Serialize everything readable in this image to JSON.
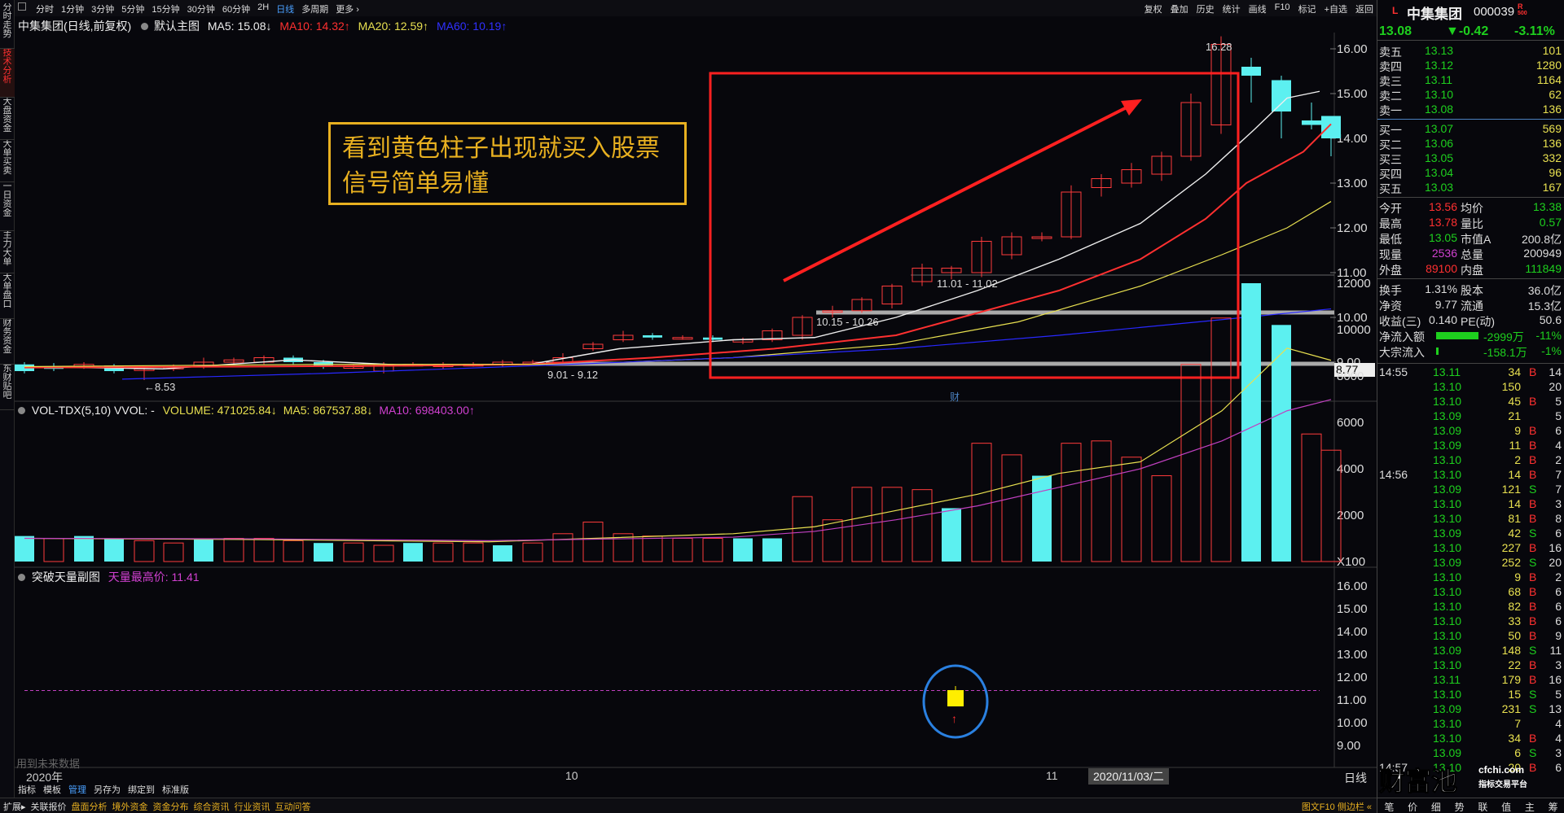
{
  "left_nav": [
    "分时走势",
    "技术分析",
    "大盘资金",
    "大单买卖",
    "一日资金",
    "主力大单",
    "大单盘口",
    "财务资金",
    "东财贴吧"
  ],
  "periods": [
    "分时",
    "1分钟",
    "3分钟",
    "5分钟",
    "15分钟",
    "30分钟",
    "60分钟",
    "2H",
    "日线",
    "多周期",
    "更多 ›"
  ],
  "period_active": "日线",
  "right_toolbar": [
    "复权",
    "叠加",
    "历史",
    "统计",
    "画线",
    "F10",
    "标记",
    "+自选",
    "返回"
  ],
  "main_info": {
    "stock": "中集集团(日线,前复权)",
    "template": "默认主图",
    "ma5": "MA5: 15.08↓",
    "ma10": "MA10: 14.32↑",
    "ma20": "MA20: 12.59↑",
    "ma60": "MA60: 10.19↑"
  },
  "price_axis": [
    "16.00",
    "15.00",
    "14.00",
    "13.00",
    "12.00",
    "11.00",
    "10.00",
    "9.00"
  ],
  "current_price_tag": "8.77",
  "annotations": {
    "high": "16.28",
    "low": "←8.53",
    "range1": "9.01 - 9.12",
    "range2": "10.15 - 10.26",
    "range3": "11.01 - 11.02",
    "cai": "财"
  },
  "callout": {
    "line1": "看到黄色柱子出现就买入股票",
    "line2": "信号简单易懂"
  },
  "vol_info": {
    "name": "VOL-TDX(5,10) VVOL: -",
    "volume": "VOLUME: 471025.84↓",
    "ma5": "MA5: 867537.88↓",
    "ma10": "MA10: 698403.00↑"
  },
  "vol_axis": [
    "12000",
    "10000",
    "8000",
    "6000",
    "4000",
    "2000",
    "X100"
  ],
  "ind_info": {
    "name": "突破天量副图",
    "label": "天量最高价: 11.41"
  },
  "ind_axis": [
    "16.00",
    "15.00",
    "14.00",
    "13.00",
    "12.00",
    "11.00",
    "10.00",
    "9.00"
  ],
  "bottom_note": "用到未来数据",
  "time_axis": {
    "year": "2020年",
    "m10": "10",
    "m11": "11",
    "cursor": "2020/11/03/二",
    "period": "日线"
  },
  "bottom_tabs": [
    "指标",
    "模板",
    "管理",
    "另存为",
    "绑定到",
    "标准版"
  ],
  "status_items": [
    "扩展▸",
    "关联报价",
    "盘面分析",
    "境外资金",
    "资金分布",
    "综合资讯",
    "行业资讯",
    "互动问答"
  ],
  "status_right": "图文F10 侧边栏 «",
  "quote": {
    "name": "中集集团",
    "code": "000039",
    "price": "13.08",
    "change": "▼-0.42",
    "pct": "-3.11%",
    "asks": [
      [
        "卖五",
        "13.13",
        "101"
      ],
      [
        "卖四",
        "13.12",
        "1280"
      ],
      [
        "卖三",
        "13.11",
        "1164"
      ],
      [
        "卖二",
        "13.10",
        "62"
      ],
      [
        "卖一",
        "13.08",
        "136"
      ]
    ],
    "bids": [
      [
        "买一",
        "13.07",
        "569"
      ],
      [
        "买二",
        "13.06",
        "136"
      ],
      [
        "买三",
        "13.05",
        "332"
      ],
      [
        "买四",
        "13.04",
        "96"
      ],
      [
        "买五",
        "13.03",
        "167"
      ]
    ],
    "stats": [
      [
        "今开",
        "13.56",
        "均价",
        "13.38"
      ],
      [
        "最高",
        "13.78",
        "量比",
        "0.57"
      ],
      [
        "最低",
        "13.05",
        "市值A",
        "200.8亿"
      ],
      [
        "现量",
        "2536",
        "总量",
        "200949"
      ],
      [
        "外盘",
        "89100",
        "内盘",
        "111849"
      ],
      [
        "换手",
        "1.31%",
        "股本",
        "36.0亿"
      ],
      [
        "净资",
        "9.77",
        "流通",
        "15.3亿"
      ],
      [
        "收益(三)",
        "0.140",
        "PE(动)",
        "50.6"
      ]
    ],
    "flows": [
      [
        "净流入额",
        "-2999万",
        "-11%"
      ],
      [
        "大宗流入",
        "-158.1万",
        "-1%"
      ]
    ]
  },
  "ticks": [
    {
      "time": "14:55",
      "price": "13.11",
      "vol": "34",
      "side": "B",
      "n": "14"
    },
    {
      "time": "",
      "price": "13.10",
      "vol": "150",
      "side": "",
      "n": "20"
    },
    {
      "time": "",
      "price": "13.10",
      "vol": "45",
      "side": "B",
      "n": "5"
    },
    {
      "time": "",
      "price": "13.09",
      "vol": "21",
      "side": "",
      "n": "5"
    },
    {
      "time": "",
      "price": "13.09",
      "vol": "9",
      "side": "B",
      "n": "6"
    },
    {
      "time": "",
      "price": "13.09",
      "vol": "11",
      "side": "B",
      "n": "4"
    },
    {
      "time": "",
      "price": "13.10",
      "vol": "2",
      "side": "B",
      "n": "2"
    },
    {
      "time": "14:56",
      "price": "13.10",
      "vol": "14",
      "side": "B",
      "n": "7"
    },
    {
      "time": "",
      "price": "13.09",
      "vol": "121",
      "side": "S",
      "n": "7"
    },
    {
      "time": "",
      "price": "13.10",
      "vol": "14",
      "side": "B",
      "n": "3"
    },
    {
      "time": "",
      "price": "13.10",
      "vol": "81",
      "side": "B",
      "n": "8"
    },
    {
      "time": "",
      "price": "13.09",
      "vol": "42",
      "side": "S",
      "n": "6"
    },
    {
      "time": "",
      "price": "13.10",
      "vol": "227",
      "side": "B",
      "n": "16"
    },
    {
      "time": "",
      "price": "13.09",
      "vol": "252",
      "side": "S",
      "n": "20"
    },
    {
      "time": "",
      "price": "13.10",
      "vol": "9",
      "side": "B",
      "n": "2"
    },
    {
      "time": "",
      "price": "13.10",
      "vol": "68",
      "side": "B",
      "n": "6"
    },
    {
      "time": "",
      "price": "13.10",
      "vol": "82",
      "side": "B",
      "n": "6"
    },
    {
      "time": "",
      "price": "13.10",
      "vol": "33",
      "side": "B",
      "n": "6"
    },
    {
      "time": "",
      "price": "13.10",
      "vol": "50",
      "side": "B",
      "n": "9"
    },
    {
      "time": "",
      "price": "13.09",
      "vol": "148",
      "side": "S",
      "n": "11"
    },
    {
      "time": "",
      "price": "13.10",
      "vol": "22",
      "side": "B",
      "n": "3"
    },
    {
      "time": "",
      "price": "13.11",
      "vol": "179",
      "side": "B",
      "n": "16"
    },
    {
      "time": "",
      "price": "13.10",
      "vol": "15",
      "side": "S",
      "n": "5"
    },
    {
      "time": "",
      "price": "13.09",
      "vol": "231",
      "side": "S",
      "n": "13"
    },
    {
      "time": "",
      "price": "13.10",
      "vol": "7",
      "side": "",
      "n": "4"
    },
    {
      "time": "",
      "price": "13.10",
      "vol": "34",
      "side": "B",
      "n": "4"
    },
    {
      "time": "",
      "price": "13.09",
      "vol": "6",
      "side": "S",
      "n": "3"
    },
    {
      "time": "14:57",
      "price": "13.10",
      "vol": "20",
      "side": "B",
      "n": "6"
    }
  ],
  "right_bottom_tabs": [
    "笔",
    "价",
    "细",
    "势",
    "联",
    "值",
    "主",
    "筹"
  ],
  "watermark": {
    "big": "财富池",
    "small1": "cfchi.com",
    "small2": "指标交易平台"
  }
}
